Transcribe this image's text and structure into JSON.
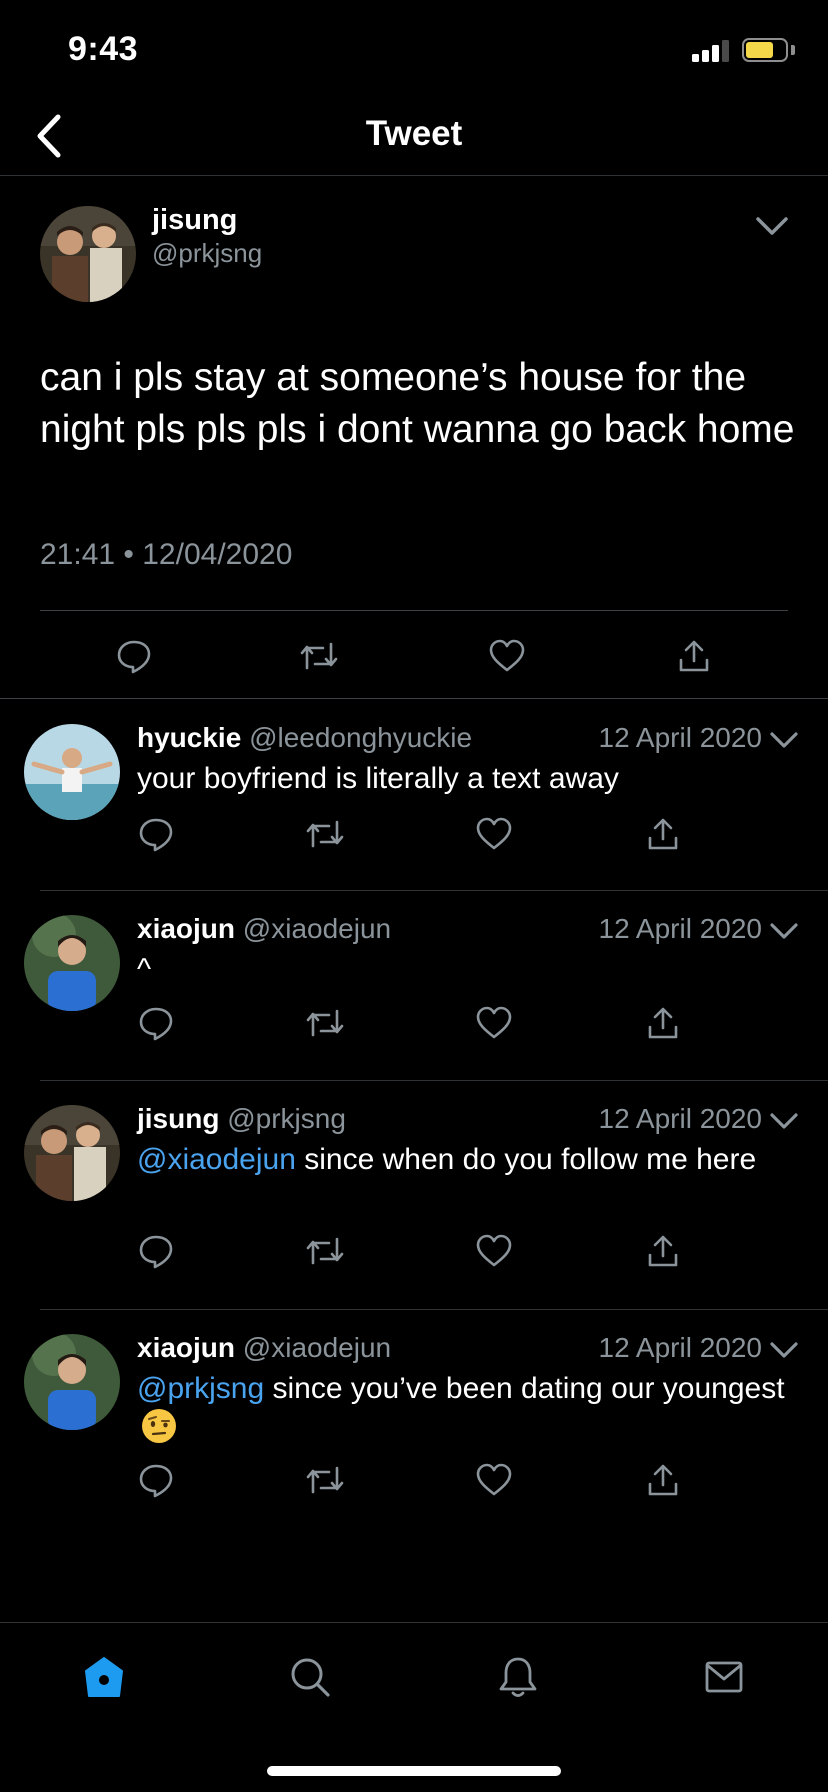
{
  "status_bar": {
    "time": "9:43",
    "battery_color": "#f5d74a"
  },
  "nav": {
    "title": "Tweet",
    "back_icon": "chevron-left-icon"
  },
  "main_tweet": {
    "name": "jisung",
    "handle": "@prkjsng",
    "text": "can i pls stay at someone’s house for the night pls pls pls i dont wanna go back home",
    "meta": "21:41 • 12/04/2020"
  },
  "replies": [
    {
      "name": "hyuckie",
      "handle": "@leedonghyuckie",
      "date": "12 April 2020",
      "mention": "",
      "text": "your boyfriend is literally a text away"
    },
    {
      "name": "xiaojun",
      "handle": "@xiaodejun",
      "date": "12 April 2020",
      "mention": "",
      "text": "^"
    },
    {
      "name": "jisung",
      "handle": "@prkjsng",
      "date": "12 April 2020",
      "mention": "@xiaodejun",
      "text": " since when do you follow me here"
    },
    {
      "name": "xiaojun",
      "handle": "@xiaodejun",
      "date": "12 April 2020",
      "mention": "@prkjsng",
      "text": " since you’ve been dating our youngest",
      "emoji": "face-with-raised-eyebrow-emoji"
    }
  ],
  "tab_bar": {
    "items": [
      "home-icon",
      "search-icon",
      "bell-icon",
      "mail-icon"
    ],
    "active": "home-icon",
    "active_color": "#1d9bf0"
  },
  "colors": {
    "background": "#000000",
    "secondary_text": "#8b949a",
    "mention": "#4aa3ef",
    "divider": "#2f3336"
  }
}
